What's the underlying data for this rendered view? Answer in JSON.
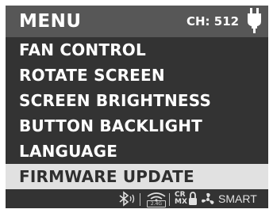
{
  "header": {
    "title": "MENU",
    "channel": "CH: 512"
  },
  "menu": {
    "items": [
      {
        "label": "FAN CONTROL",
        "selected": false
      },
      {
        "label": "ROTATE SCREEN",
        "selected": false
      },
      {
        "label": "SCREEN BRIGHTNESS",
        "selected": false
      },
      {
        "label": "BUTTON BACKLIGHT",
        "selected": false
      },
      {
        "label": "LANGUAGE",
        "selected": false
      },
      {
        "label": "FIRMWARE UPDATE",
        "selected": true
      }
    ]
  },
  "status_bar": {
    "frequency_badge": "2.4G",
    "crmx": "CR\nMX",
    "mode": "SMART",
    "icons": [
      "bluetooth-icon",
      "wifi-icon",
      "crmx-icon",
      "lock-icon",
      "fan-icon",
      "plug-icon"
    ]
  },
  "colors": {
    "screen_bg": "#333333",
    "header_bg": "#575757",
    "selected_bg": "#e1e1e1",
    "selected_text": "#2f2f2f",
    "text": "#ffffff"
  }
}
